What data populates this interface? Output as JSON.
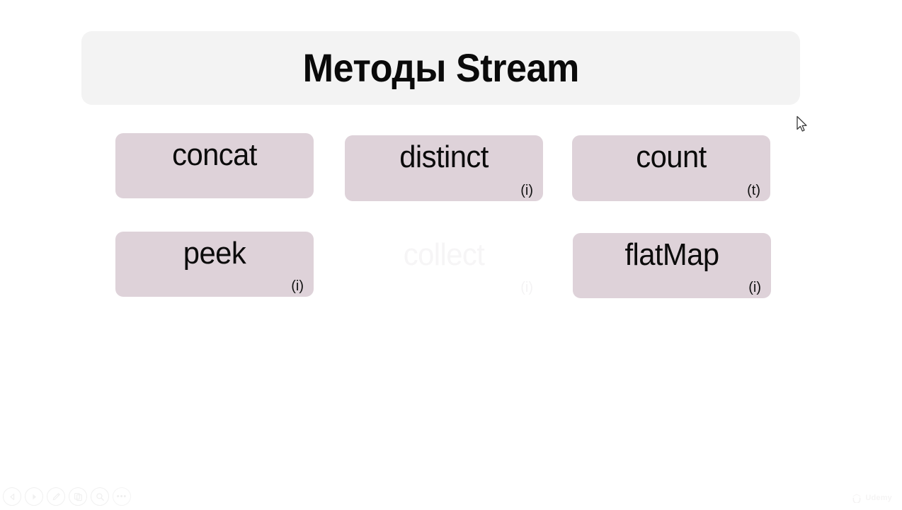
{
  "slide": {
    "title": "Методы Stream",
    "background_color": "#ffffff",
    "panel_color": "#f3f3f3",
    "box_color": "#ded2d9"
  },
  "methods": [
    {
      "name": "concat",
      "tag": "",
      "state": "visible"
    },
    {
      "name": "distinct",
      "tag": "(i)",
      "state": "visible"
    },
    {
      "name": "count",
      "tag": "(t)",
      "state": "visible"
    },
    {
      "name": "peek",
      "tag": "(i)",
      "state": "visible"
    },
    {
      "name": "collect",
      "tag": "(i)",
      "state": "faded"
    },
    {
      "name": "flatMap",
      "tag": "(i)",
      "state": "visible"
    }
  ],
  "toolbar": {
    "prev_label": "Previous",
    "next_label": "Next",
    "pen_label": "Pen",
    "copy_label": "Duplicate",
    "search_label": "Zoom",
    "more_label": "•••"
  },
  "watermark": {
    "brand": "Udemy"
  }
}
